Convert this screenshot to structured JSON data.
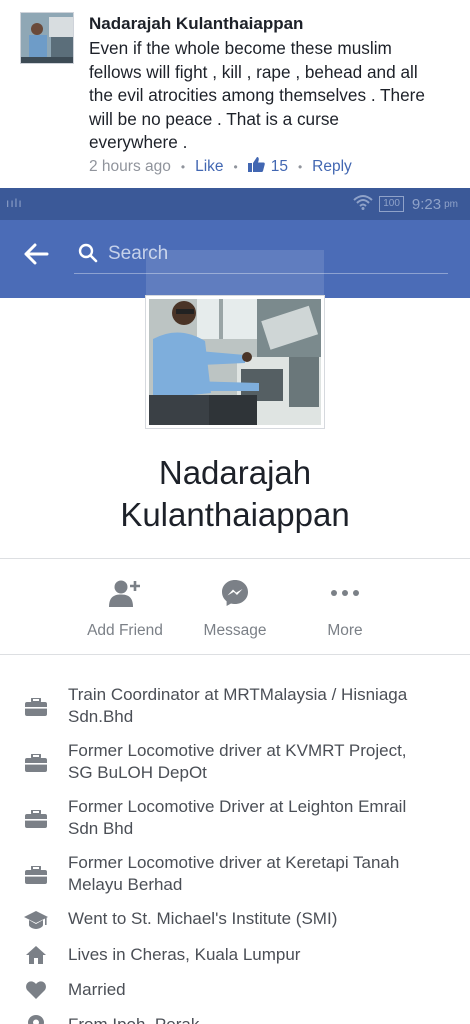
{
  "comment": {
    "author": "Nadarajah Kulanthaiappan",
    "lines": [
      "Even if the whole become these muslim",
      "fellows will fight , kill , rape , behead and all",
      "the evil atrocities among themselves . There",
      "will be no peace . That is a curse",
      "everywhere ."
    ],
    "time": "2 hours ago",
    "like_label": "Like",
    "like_count": "15",
    "reply_label": "Reply",
    "link_color": "#4267b2"
  },
  "status_bar": {
    "signal": "ıılı",
    "battery": "100",
    "time": "9:23",
    "ampm": "pm"
  },
  "search": {
    "placeholder": "Search"
  },
  "profile": {
    "name_line1": "Nadarajah",
    "name_line2": "Kulanthaiappan"
  },
  "actions": {
    "add_friend": "Add Friend",
    "message": "Message",
    "more": "More"
  },
  "about": [
    {
      "icon": "briefcase-icon",
      "lines": [
        "Train Coordinator at MRTMalaysia / Hisniaga",
        "Sdn.Bhd"
      ]
    },
    {
      "icon": "briefcase-icon",
      "lines": [
        "Former Locomotive driver at KVMRT Project,",
        "SG BuLOH DepOt"
      ]
    },
    {
      "icon": "briefcase-icon",
      "lines": [
        "Former Locomotive Driver at Leighton Emrail",
        "Sdn Bhd"
      ]
    },
    {
      "icon": "briefcase-icon",
      "lines": [
        "Former Locomotive driver at Keretapi Tanah",
        "Melayu Berhad"
      ]
    },
    {
      "icon": "graduation-cap-icon",
      "lines": [
        "Went to St. Michael's Institute (SMI)"
      ]
    },
    {
      "icon": "home-icon",
      "lines": [
        "Lives in Cheras, Kuala Lumpur"
      ]
    },
    {
      "icon": "heart-icon",
      "lines": [
        "Married"
      ]
    },
    {
      "icon": "location-pin-icon",
      "lines": [
        "From Ipoh, Perak"
      ]
    }
  ],
  "colors": {
    "header_blue": "#4b6cb7",
    "status_blue": "#3b5998",
    "text_gray": "#4b4f56"
  }
}
